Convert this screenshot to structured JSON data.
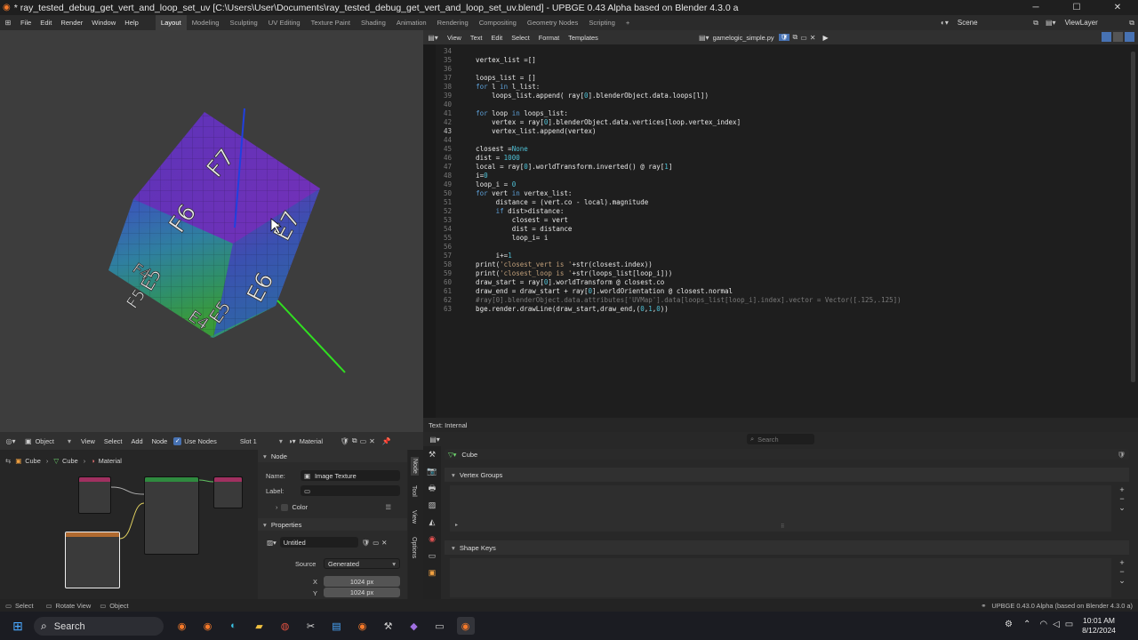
{
  "window": {
    "title": "* ray_tested_debug_get_vert_and_loop_set_uv [C:\\Users\\User\\Documents\\ray_tested_debug_get_vert_and_loop_set_uv.blend] - UPBGE 0.43 Alpha based on Blender 4.3.0 a"
  },
  "menubar": {
    "items": [
      "File",
      "Edit",
      "Render",
      "Window",
      "Help"
    ],
    "workspaces": [
      "Layout",
      "Modeling",
      "Sculpting",
      "UV Editing",
      "Texture Paint",
      "Shading",
      "Animation",
      "Rendering",
      "Compositing",
      "Geometry Nodes",
      "Scripting"
    ],
    "add": "+",
    "scene": "Scene",
    "view_layer": "ViewLayer"
  },
  "viewport": {
    "labels": [
      "F7",
      "F6",
      "E7",
      "E6",
      "E5",
      "E5",
      "F5",
      "E4",
      "F4"
    ]
  },
  "text_editor": {
    "menus": [
      "View",
      "Text",
      "Edit",
      "Select",
      "Format",
      "Templates"
    ],
    "filename": "gamelogic_simple.py",
    "footer": "Text: Internal",
    "current_line": "43",
    "lines": [
      {
        "n": "34",
        "t": ""
      },
      {
        "n": "35",
        "t": "    vertex_list =[]"
      },
      {
        "n": "36",
        "t": ""
      },
      {
        "n": "37",
        "t": "    loops_list = []"
      },
      {
        "n": "38",
        "t": "    for l in l_list:"
      },
      {
        "n": "39",
        "t": "        loops_list.append( ray[0].blenderObject.data.loops[l])"
      },
      {
        "n": "40",
        "t": ""
      },
      {
        "n": "41",
        "t": "    for loop in loops_list:"
      },
      {
        "n": "42",
        "t": "        vertex = ray[0].blenderObject.data.vertices[loop.vertex_index]"
      },
      {
        "n": "43",
        "t": "        vertex_list.append(vertex)"
      },
      {
        "n": "44",
        "t": ""
      },
      {
        "n": "45",
        "t": "    closest =None"
      },
      {
        "n": "46",
        "t": "    dist = 1000"
      },
      {
        "n": "47",
        "t": "    local = ray[0].worldTransform.inverted() @ ray[1]"
      },
      {
        "n": "48",
        "t": "    i=0"
      },
      {
        "n": "49",
        "t": "    loop_i = 0"
      },
      {
        "n": "50",
        "t": "    for vert in vertex_list:"
      },
      {
        "n": "51",
        "t": "         distance = (vert.co - local).magnitude"
      },
      {
        "n": "52",
        "t": "         if dist>distance:"
      },
      {
        "n": "53",
        "t": "             closest = vert"
      },
      {
        "n": "54",
        "t": "             dist = distance"
      },
      {
        "n": "55",
        "t": "             loop_i= i"
      },
      {
        "n": "56",
        "t": ""
      },
      {
        "n": "57",
        "t": "         i+=1"
      },
      {
        "n": "58",
        "t": "    print('closest_vert is '+str(closest.index))"
      },
      {
        "n": "59",
        "t": "    print('closest_loop is '+str(loops_list[loop_i]))"
      },
      {
        "n": "60",
        "t": "    draw_start = ray[0].worldTransform @ closest.co"
      },
      {
        "n": "61",
        "t": "    draw_end = draw_start + ray[0].worldOrientation @ closest.normal"
      },
      {
        "n": "62",
        "t": "    #ray[0].blenderObject.data.attributes['UVMap'].data[loops_list[loop_i].index].vector = Vector([.125,.125])"
      },
      {
        "n": "63",
        "t": "    bge.render.drawLine(draw_start,draw_end,(0,1,0))"
      }
    ]
  },
  "node_editor": {
    "header": {
      "mode": "Object",
      "menus": [
        "View",
        "Select",
        "Add",
        "Node"
      ],
      "use_nodes": "Use Nodes",
      "slot": "Slot 1",
      "material": "Material"
    },
    "breadcrumb": [
      "Cube",
      "Cube",
      "Material"
    ],
    "panel": {
      "section_node": "Node",
      "name_label": "Name:",
      "name_value": "Image Texture",
      "label_label": "Label:",
      "color": "Color",
      "properties": "Properties",
      "image": "Untitled",
      "source_label": "Source",
      "source_value": "Generated",
      "x_label": "X",
      "x_value": "1024 px",
      "y_label": "Y",
      "y_value": "1024 px"
    },
    "tabs": [
      "Node",
      "Tool",
      "View",
      "Options"
    ]
  },
  "properties": {
    "search_placeholder": "Search",
    "object": "Cube",
    "vertex_groups": "Vertex Groups",
    "shape_keys": "Shape Keys"
  },
  "statusbar": {
    "select": "Select",
    "rotate": "Rotate View",
    "object": "Object",
    "version": "UPBGE 0.43.0 Alpha (based on Blender 4.3.0 a)"
  },
  "taskbar": {
    "search": "Search",
    "time": "10:01 AM",
    "date": "8/12/2024"
  },
  "colors": {
    "accent": "#4772b3",
    "keyword": "#5c9fd6",
    "number": "#4fc1d6",
    "string": "#c2a07a"
  }
}
